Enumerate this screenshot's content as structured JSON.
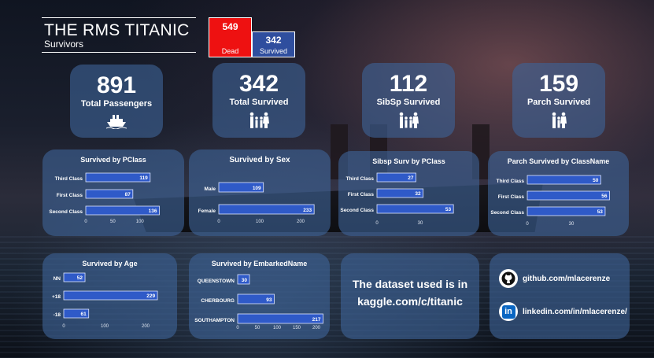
{
  "header": {
    "title": "THE RMS TITANIC",
    "subtitle": "Survivors"
  },
  "mini": {
    "dead_value": "549",
    "dead_label": "Dead",
    "survived_value": "342",
    "survived_label": "Survived"
  },
  "kpis": [
    {
      "value": "891",
      "label": "Total Passengers",
      "icon": "ship-icon"
    },
    {
      "value": "342",
      "label": "Total Survived",
      "icon": "family-icon"
    },
    {
      "value": "112",
      "label": "SibSp Survived",
      "icon": "family-icon"
    },
    {
      "value": "159",
      "label": "Parch Survived",
      "icon": "family-icon"
    }
  ],
  "info": {
    "line1": "The dataset used is in",
    "line2": "kaggle.com/c/titanic"
  },
  "links": {
    "github": "github.com/mlacerenze",
    "linkedin": "linkedin.com/in/mlacerenze/",
    "linkedin_badge": "in"
  },
  "colors": {
    "bar": "#2f5ac8",
    "dead": "#ee1111",
    "survived": "#2f4e9e",
    "card": "#3e6296"
  },
  "chart_data": [
    {
      "type": "bar",
      "title": "Survived by PClass",
      "categories": [
        "Third Class",
        "First Class",
        "Second Class"
      ],
      "values": [
        119,
        87,
        136
      ],
      "xlim": [
        0,
        160
      ],
      "xticks": [
        "0",
        "50",
        "100"
      ]
    },
    {
      "type": "bar",
      "title": "Survived by Sex",
      "categories": [
        "Male",
        "Female"
      ],
      "values": [
        109,
        233
      ],
      "xlim": [
        0,
        250
      ],
      "xticks": [
        "0",
        "100",
        "200"
      ]
    },
    {
      "type": "bar",
      "title": "Sibsp Surv by PClass",
      "categories": [
        "Third Class",
        "First Class",
        "Second Class"
      ],
      "values": [
        27,
        32,
        53
      ],
      "xlim": [
        0,
        60
      ],
      "xticks": [
        "0",
        "30"
      ]
    },
    {
      "type": "bar",
      "title": "Parch Survived by ClassName",
      "categories": [
        "Third Class",
        "First Class",
        "Second Class"
      ],
      "values": [
        50,
        56,
        53
      ],
      "xlim": [
        0,
        60
      ],
      "xticks": [
        "0",
        "30"
      ]
    },
    {
      "type": "bar",
      "title": "Survived by Age",
      "categories": [
        "NN",
        "+18",
        "-18"
      ],
      "values": [
        52,
        229,
        61
      ],
      "xlim": [
        0,
        250
      ],
      "xticks": [
        "0",
        "100",
        "200"
      ]
    },
    {
      "type": "bar",
      "title": "Survived by EmbarkedName",
      "categories": [
        "QUEENSTOWN",
        "CHERBOURG",
        "SOUTHAMPTON"
      ],
      "values": [
        30,
        93,
        217
      ],
      "xlim": [
        0,
        220
      ],
      "xticks": [
        "0",
        "50",
        "100",
        "150",
        "200"
      ]
    }
  ]
}
